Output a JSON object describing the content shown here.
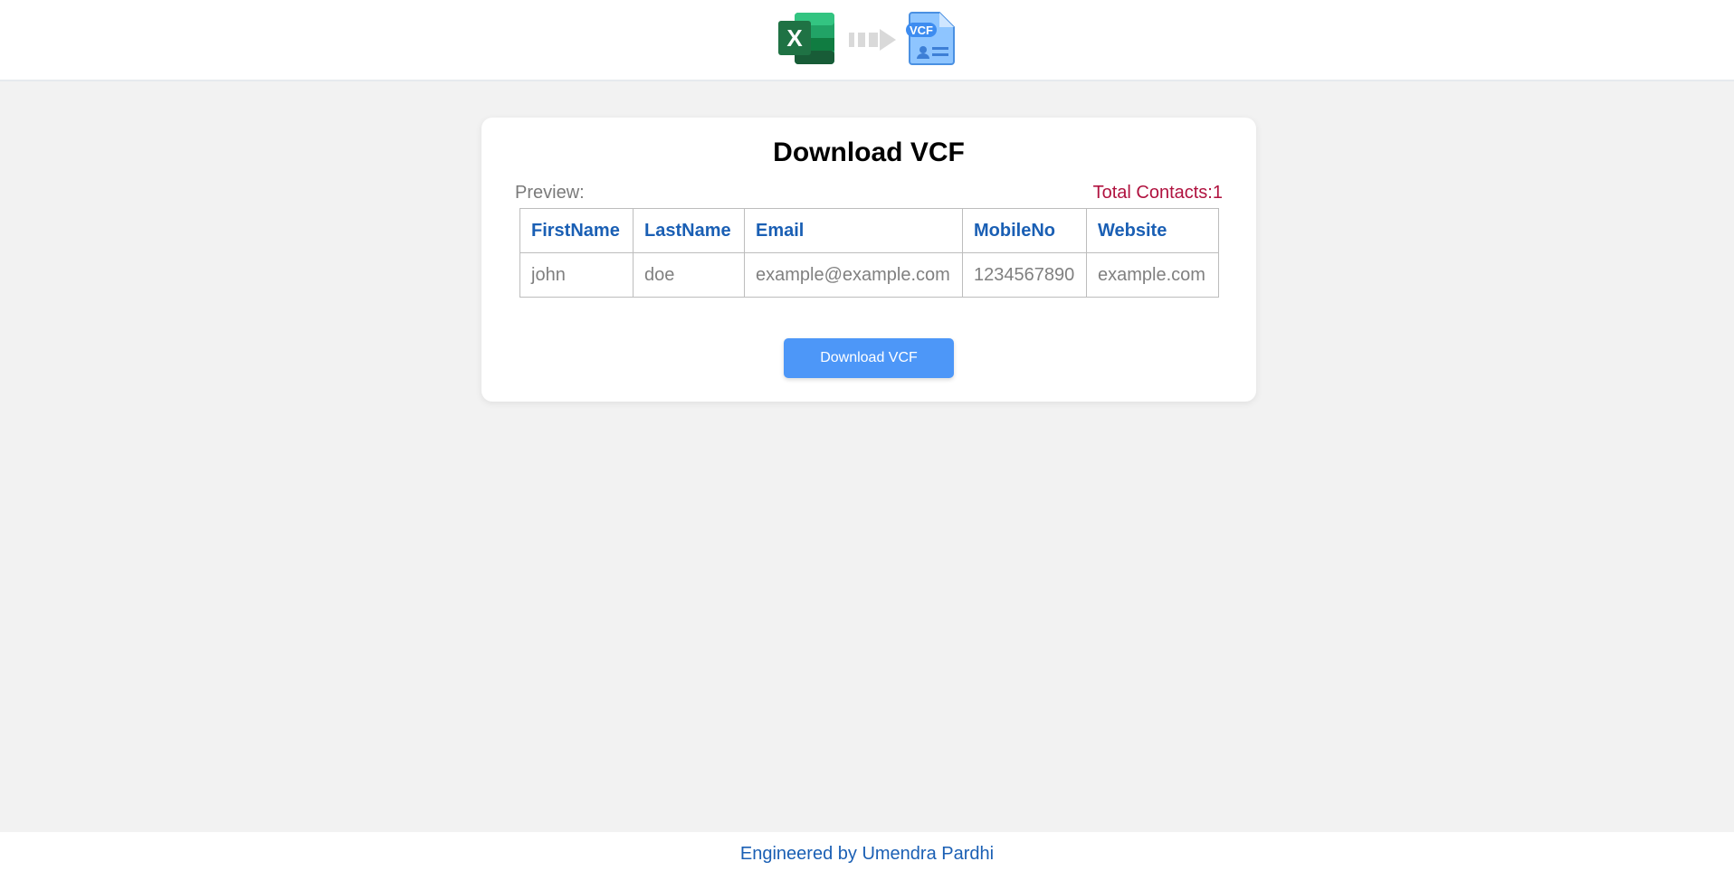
{
  "header": {
    "logo_left_icon": "excel-icon",
    "logo_left_letter": "X",
    "arrow_icon": "arrow-right-icon",
    "logo_right_icon": "vcf-file-icon",
    "logo_right_badge": "VCF"
  },
  "card": {
    "title": "Download VCF",
    "preview_label": "Preview:",
    "total_contacts": "Total Contacts:1"
  },
  "table": {
    "headers": [
      "FirstName",
      "LastName",
      "Email",
      "MobileNo",
      "Website"
    ],
    "rows": [
      [
        "john",
        "doe",
        "example@example.com",
        "1234567890",
        "example.com"
      ]
    ]
  },
  "actions": {
    "download_label": "Download VCF"
  },
  "footer": {
    "credit": "Engineered by Umendra Pardhi"
  },
  "colors": {
    "accent": "#4d97f8",
    "header_text": "#1a5fb4",
    "total_text": "#b0123f",
    "excel_green": "#1f7244"
  }
}
